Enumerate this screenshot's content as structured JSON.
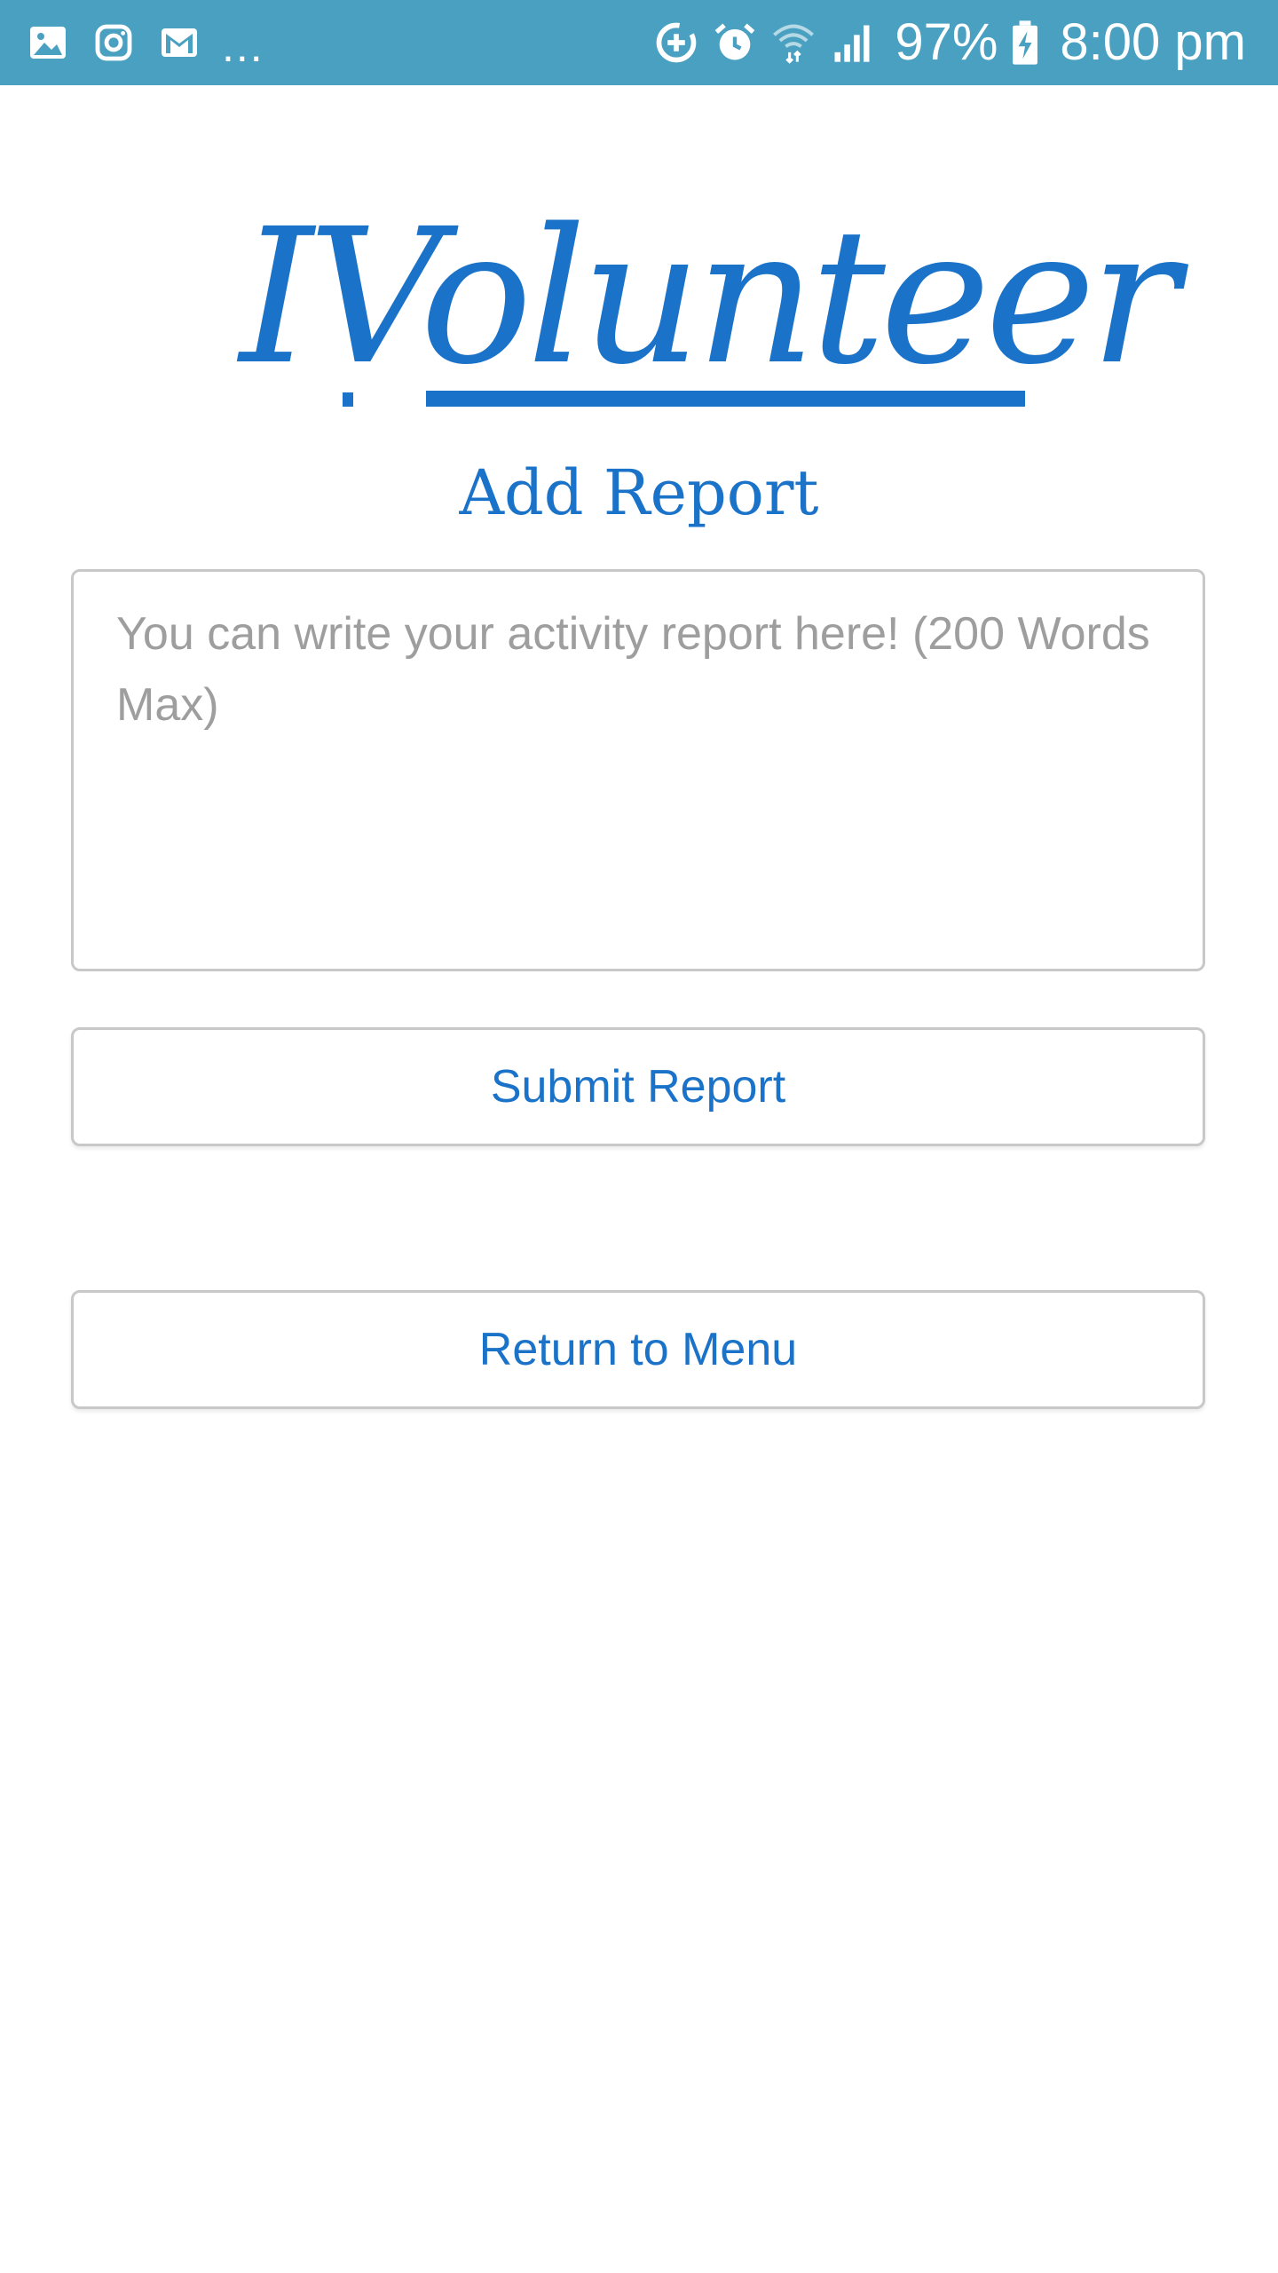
{
  "status_bar": {
    "left_icons": [
      "gallery-icon",
      "instagram-icon",
      "gmail-icon"
    ],
    "more_indicator": "...",
    "right_icons": [
      "data-saver-icon",
      "alarm-icon",
      "wifi-icon",
      "signal-icon",
      "battery-charging-icon"
    ],
    "battery_percent": "97%",
    "time": "8:00 pm",
    "background_color": "#4aa0c1"
  },
  "logo": {
    "text": "IVolunteer",
    "color": "#1a73c9"
  },
  "page": {
    "title": "Add Report"
  },
  "report_form": {
    "input_value": "",
    "input_placeholder": "You can write your activity report here! (200 Words Max)",
    "submit_label": "Submit Report",
    "return_label": "Return to Menu"
  },
  "colors": {
    "accent": "#1a73c9",
    "border": "#c8c8c8",
    "placeholder": "#9e9e9e"
  }
}
